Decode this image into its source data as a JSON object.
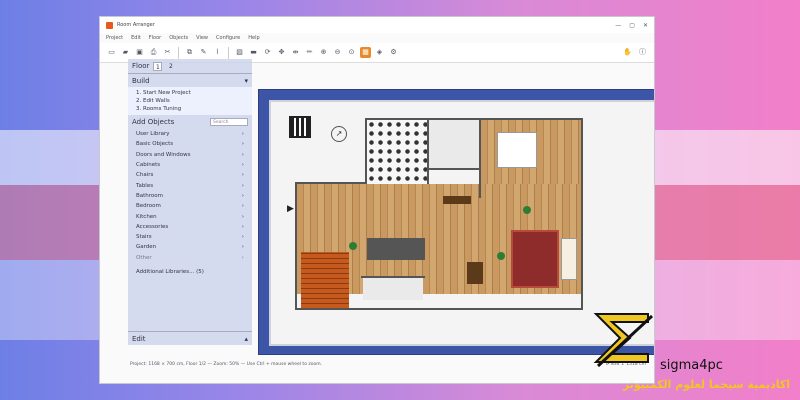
{
  "window": {
    "title": "Room Arranger",
    "controls": [
      "—",
      "▢",
      "✕"
    ]
  },
  "menu": [
    "Project",
    "Edit",
    "Floor",
    "Objects",
    "View",
    "Configure",
    "Help"
  ],
  "toolbar": [
    "new",
    "open",
    "save",
    "print",
    "cut",
    "copy",
    "paint",
    "settings",
    "wall",
    "door",
    "rotate",
    "measure",
    "zoom-in",
    "zoom-out",
    "3d",
    "active",
    "camera"
  ],
  "sidebar": {
    "floor_label": "Floor",
    "floors": [
      "1",
      "2"
    ],
    "build_label": "Build",
    "build_items": [
      "1. Start New Project",
      "2. Edit Walls",
      "3. Rooms Tuning"
    ],
    "add_objects_label": "Add Objects",
    "search_placeholder": "Search",
    "object_items": [
      "User Library",
      "Basic Objects",
      "Doors and Windows",
      "Cabinets",
      "Chairs",
      "Tables",
      "Bathroom",
      "Bedroom",
      "Kitchen",
      "Accessories",
      "Stairs",
      "Garden",
      "Other"
    ],
    "additional": "Additional Libraries... (5)",
    "edit_label": "Edit"
  },
  "status": {
    "left": "Project: 1168 × 700 cm, Floor 1/2 — Zoom: 50% — Use Ctrl + mouse wheel to zoom.",
    "right": "⊳ 834 ↕ 1518 cm"
  },
  "brand": {
    "name": "sigma4pc",
    "arabic": "اكاديمية سيجما لعلوم الكمبيوتر"
  }
}
